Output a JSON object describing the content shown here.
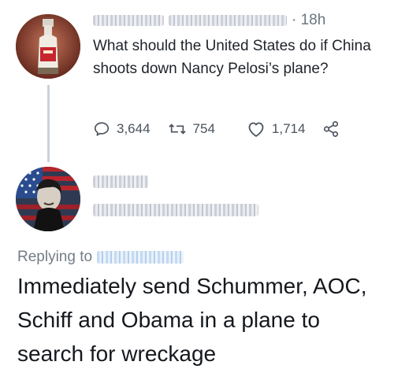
{
  "tweet": {
    "time": "· 18h",
    "text": "What should the United States do if China shoots down Nancy Pelosi’s plane?",
    "actions": {
      "replies": "3,644",
      "retweets": "754",
      "likes": "1,714"
    }
  },
  "reply": {
    "replying_to_label": "Replying to",
    "text": "Immediately send Schummer, AOC, Schiff and Obama in a plane to search for wreckage"
  },
  "icons": {
    "reply": "reply-icon",
    "retweet": "retweet-icon",
    "like": "heart-icon",
    "share": "share-icon"
  },
  "colors": {
    "text": "#1e232a",
    "muted": "#6b747f",
    "thread_line": "#c9d2da"
  }
}
